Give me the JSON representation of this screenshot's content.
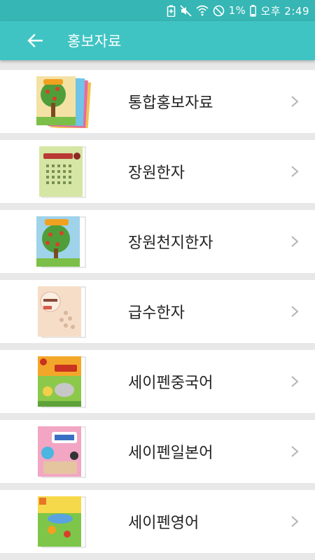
{
  "status_bar": {
    "battery_percent": "1%",
    "time": "오후 2:49",
    "icons": [
      "battery-saver-icon",
      "mute-icon",
      "wifi-icon",
      "no-disturb-icon",
      "battery-icon"
    ]
  },
  "app_bar": {
    "title": "홍보자료",
    "background": "#3fc4c3",
    "back_icon": "arrow-back-icon"
  },
  "items": [
    {
      "label": "통합홍보자료",
      "thumb_icon": "book-stack-cover-icon"
    },
    {
      "label": "장원한자",
      "thumb_icon": "book-cover-green-icon"
    },
    {
      "label": "장원천지한자",
      "thumb_icon": "book-cover-tree-icon"
    },
    {
      "label": "급수한자",
      "thumb_icon": "book-cover-beige-icon"
    },
    {
      "label": "세이펜중국어",
      "thumb_icon": "book-cover-orange-icon"
    },
    {
      "label": "세이펜일본어",
      "thumb_icon": "book-cover-pink-icon"
    },
    {
      "label": "세이펜영어",
      "thumb_icon": "book-cover-yellow-icon"
    }
  ]
}
